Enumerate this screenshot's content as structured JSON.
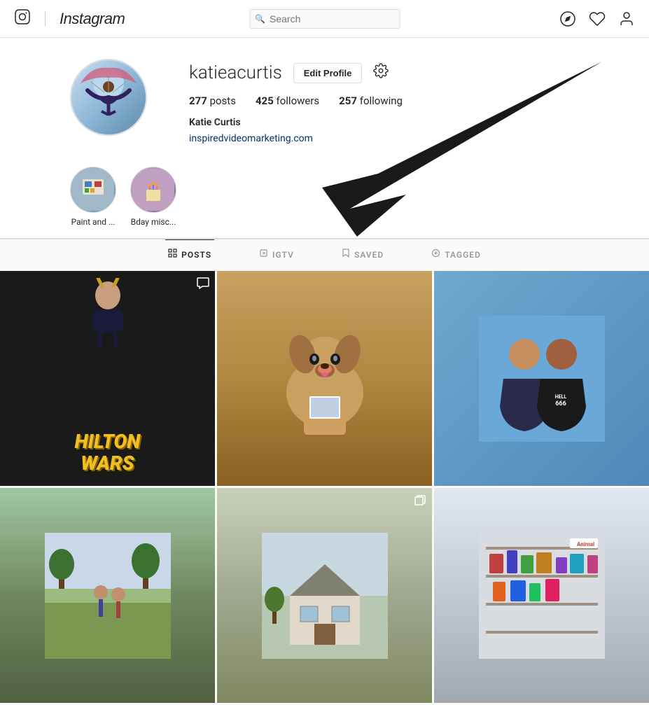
{
  "header": {
    "logo_icon": "📷",
    "wordmark": "Instagram",
    "search_placeholder": "Search",
    "icons": {
      "compass": "✦",
      "heart": "♡",
      "person": "👤"
    }
  },
  "profile": {
    "username": "katieacurtis",
    "edit_button": "Edit Profile",
    "stats": {
      "posts_count": "277",
      "posts_label": "posts",
      "followers_count": "425",
      "followers_label": "followers",
      "following_count": "257",
      "following_label": "following"
    },
    "name": "Katie Curtis",
    "website": "inspiredvideomarketing.com"
  },
  "stories": [
    {
      "label": "Paint and ..."
    },
    {
      "label": "Bday misc..."
    }
  ],
  "tabs": [
    {
      "label": "POSTS",
      "active": true
    },
    {
      "label": "IGTV",
      "active": false
    },
    {
      "label": "SAVED",
      "active": false
    },
    {
      "label": "TAGGED",
      "active": false
    }
  ],
  "photos": [
    {
      "type": "hilton-wars",
      "has_chat": true
    },
    {
      "type": "dog",
      "has_chat": false
    },
    {
      "type": "people",
      "has_chat": false
    },
    {
      "type": "outdoor",
      "has_chat": false
    },
    {
      "type": "house",
      "has_multi": true
    },
    {
      "type": "store",
      "has_chat": false
    }
  ]
}
